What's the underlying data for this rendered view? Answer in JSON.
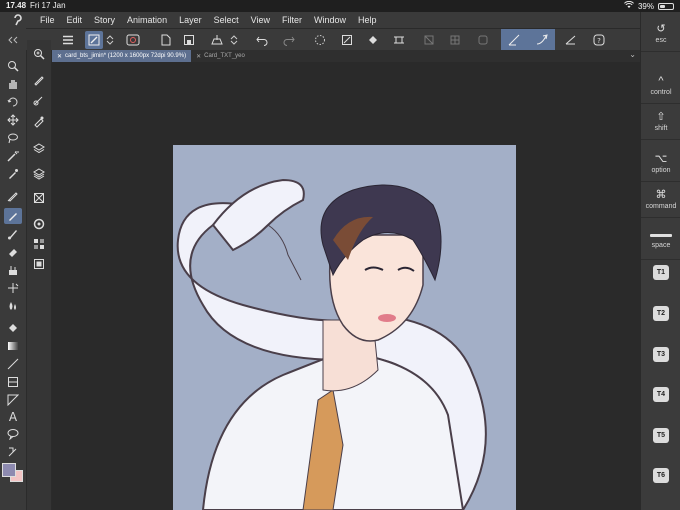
{
  "status_bar": {
    "time": "17.48",
    "date": "Fri 17 Jan",
    "battery": "39%",
    "battery_level": 0.39
  },
  "menu": [
    "File",
    "Edit",
    "Story",
    "Animation",
    "Layer",
    "Select",
    "View",
    "Filter",
    "Window",
    "Help"
  ],
  "tabs": [
    {
      "label": "card_bts_jimin* (1200 x 1600px 72dpi 90.9%)",
      "active": true
    },
    {
      "label": "Card_TXT_yeo",
      "active": false
    }
  ],
  "right_keys": [
    {
      "symbol": "↺",
      "label": "esc"
    },
    {
      "symbol": "^",
      "label": "control"
    },
    {
      "symbol": "⇧",
      "label": "shift"
    },
    {
      "symbol": "⌥",
      "label": "option"
    },
    {
      "symbol": "⌘",
      "label": "command"
    },
    {
      "symbol": "",
      "label": "space"
    }
  ],
  "tool_keys": [
    "T1",
    "T2",
    "T3",
    "T4",
    "T5",
    "T6"
  ],
  "colors": {
    "main": "#8d8ab0",
    "sub": "#f2c4c4",
    "accent": "#5d7499",
    "canvas_bg": "#a3afc7"
  },
  "toolbar_icons": [
    "menu-icon",
    "quick-access-icon",
    "lock-icon",
    "new-icon",
    "save-icon",
    "print-icon",
    "undo-icon",
    "redo-icon",
    "loading-icon",
    "fill-icon",
    "crop-icon",
    "ruler-icon",
    "stroke-icon",
    "help-icon"
  ],
  "left_tools": [
    "zoom",
    "hand",
    "rotate",
    "move",
    "lasso",
    "magic-wand",
    "eyedropper",
    "pen",
    "pencil",
    "brush",
    "airbrush",
    "eraser",
    "blend",
    "fill",
    "gradient",
    "line",
    "frame",
    "text",
    "balloon",
    "correct-line"
  ]
}
